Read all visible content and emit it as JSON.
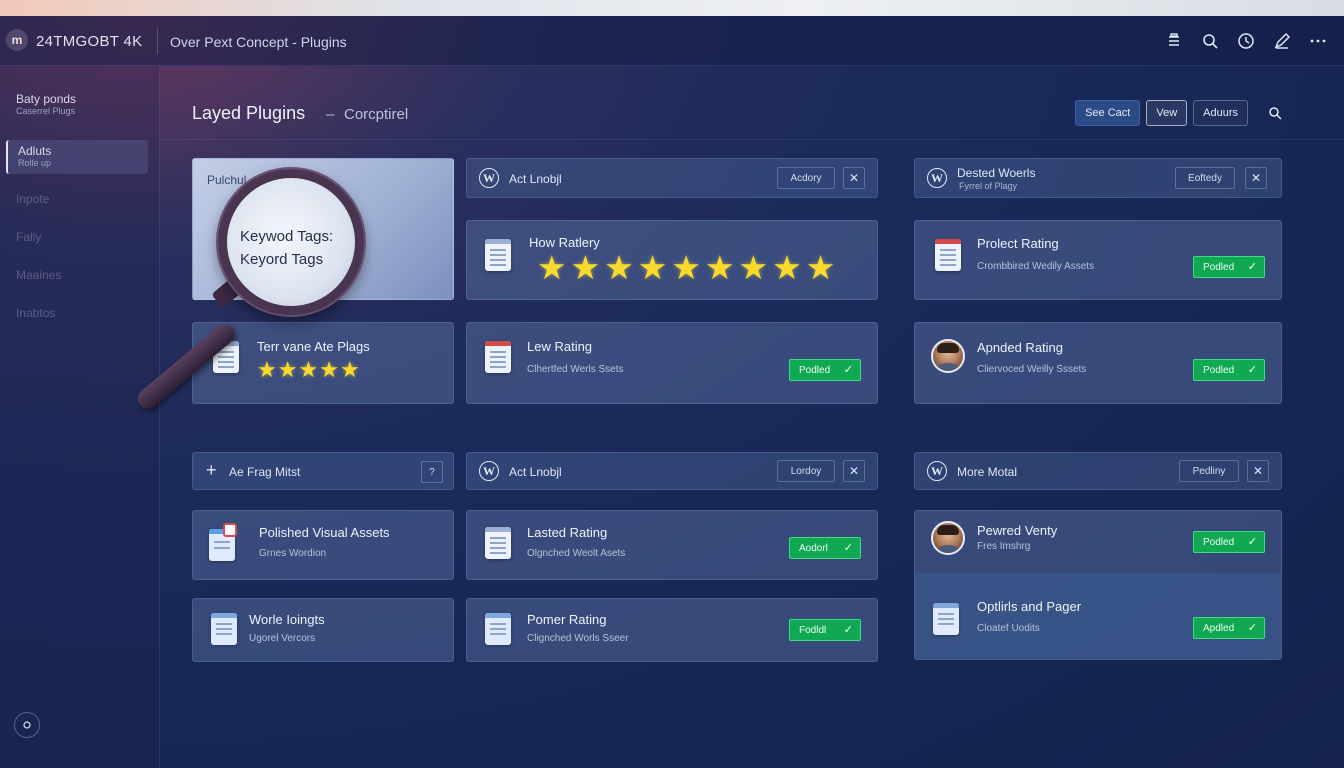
{
  "app": {
    "logo": "m",
    "name": "24TMGOBT  4K",
    "title": "Over Pext Concept - Plugins"
  },
  "toolbar_icons": [
    "list-icon",
    "search-icon",
    "clock-icon",
    "edit-icon",
    "more-icon"
  ],
  "sidebar": {
    "items": [
      {
        "label": "Baty ponds",
        "sub": "Caserrel Plugs"
      },
      {
        "label": "Adluts",
        "sub": "Rolle up"
      },
      {
        "label": "Inpote",
        "sub": ""
      },
      {
        "label": "Fally",
        "sub": ""
      },
      {
        "label": "Maaines",
        "sub": ""
      },
      {
        "label": "Inabtos",
        "sub": ""
      }
    ]
  },
  "header": {
    "title": "Layed Plugins",
    "separator": "–",
    "subtitle": "Corcptirel",
    "buttons": {
      "primary": "See Cact",
      "view": "Vew",
      "third": "Aduurs"
    }
  },
  "magnifier": {
    "line1": "Keywod Tags:",
    "line2": "Keyord Tags",
    "behind": "Pulchul"
  },
  "group1": {
    "bar2": {
      "title": "Act Lnobjl",
      "pill": "Acdory"
    },
    "bar3": {
      "title": "Dested Woerls",
      "sub": "Fyrrel of Plagy",
      "pill": "Eoftedy"
    },
    "c_stars": {
      "title": "How Ratlery",
      "stars": 9
    },
    "c_rating": {
      "title": "Prolect Rating",
      "sub": "Crombbired Wedily Assets",
      "badge": "Podled"
    },
    "c_tags": {
      "title": "Terr vane Ate Plags",
      "stars": 5
    },
    "c_lew": {
      "title": "Lew Rating",
      "sub": "Clhertfed Werls Ssets",
      "badge": "Podled"
    },
    "c_apn": {
      "title": "Apnded Rating",
      "sub": "Cliervoced Weilly Sssets",
      "badge": "Podled"
    }
  },
  "group2": {
    "bar1": {
      "title": "Ae Frag Mitst",
      "pill": "?"
    },
    "bar2": {
      "title": "Act Lnobjl",
      "pill": "Lordoy"
    },
    "bar3": {
      "title": "More Motal",
      "pill": "Pedliny"
    },
    "c_pol": {
      "title": "Polished Visual Assets",
      "sub": "Grnes Wordion"
    },
    "c_las": {
      "title": "Lasted Rating",
      "sub": "Olgnched Weolt Asets",
      "badge": "Aodorl"
    },
    "c_pew": {
      "title": "Pewred Venty",
      "sub": "Fres Imshrg",
      "badge": "Podled"
    },
    "c_wor": {
      "title": "Worle Ioingts",
      "sub": "Ugorel Vercors"
    },
    "c_pom": {
      "title": "Pomer Rating",
      "sub": "Clignched Worls Sseer",
      "badge": "Fodldl"
    },
    "c_opt": {
      "title": "Optlirls and Pager",
      "sub": "Cloatef Uodits",
      "badge": "Apdled"
    }
  },
  "colors": {
    "accent": "#2b4a86",
    "success": "#11a854",
    "star": "#f8d92c"
  }
}
